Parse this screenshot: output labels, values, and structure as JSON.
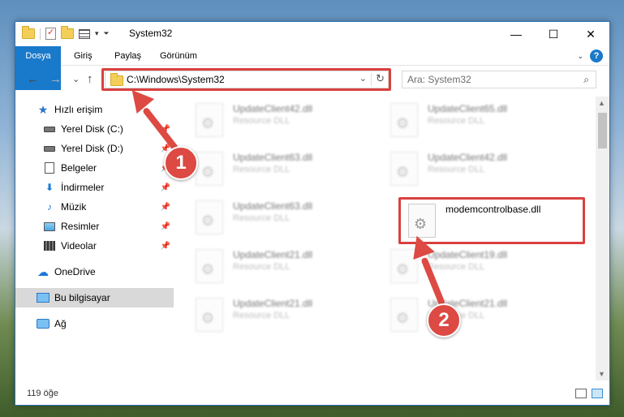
{
  "window": {
    "title": "System32",
    "controls": {
      "minimize": "—",
      "maximize": "☐",
      "close": "✕"
    }
  },
  "ribbon": {
    "tabs": [
      {
        "label": "Dosya",
        "active": true
      },
      {
        "label": "Giriş"
      },
      {
        "label": "Paylaş"
      },
      {
        "label": "Görünüm"
      }
    ],
    "help": "?"
  },
  "navigation": {
    "back": "←",
    "forward": "→",
    "recent": "⌄",
    "up": "↑",
    "address": "C:\\Windows\\System32",
    "search_placeholder": "Ara: System32"
  },
  "sidebar": {
    "items": [
      {
        "label": "Hızlı erişim",
        "icon": "star-icon"
      },
      {
        "label": "Yerel Disk (C:)",
        "icon": "drive-icon",
        "pinned": true
      },
      {
        "label": "Yerel Disk (D:)",
        "icon": "drive-icon",
        "pinned": true
      },
      {
        "label": "Belgeler",
        "icon": "documents-icon",
        "pinned": true
      },
      {
        "label": "İndirmeler",
        "icon": "downloads-icon",
        "pinned": true
      },
      {
        "label": "Müzik",
        "icon": "music-icon",
        "pinned": true
      },
      {
        "label": "Resimler",
        "icon": "pictures-icon",
        "pinned": true
      },
      {
        "label": "Videolar",
        "icon": "videos-icon",
        "pinned": true
      },
      {
        "label": "OneDrive",
        "icon": "cloud-icon"
      },
      {
        "label": "Bu bilgisayar",
        "icon": "computer-icon",
        "selected": true
      },
      {
        "label": "Ağ",
        "icon": "network-icon"
      }
    ]
  },
  "files": [
    {
      "name": "UpdateClient42.dll",
      "type": "Resource DLL"
    },
    {
      "name": "UpdateClient65.dll",
      "type": "Resource DLL"
    },
    {
      "name": "UpdateClient63.dll",
      "type": "Resource DLL"
    },
    {
      "name": "UpdateClient42.dll",
      "type": "Resource DLL"
    },
    {
      "name": "UpdateClient63.dll",
      "type": "Resource DLL"
    },
    {
      "name": "modemcontrolbase.dll",
      "type": ""
    },
    {
      "name": "UpdateClient21.dll",
      "type": "Resource DLL"
    },
    {
      "name": "UpdateClient19.dll",
      "type": "Resource DLL"
    },
    {
      "name": "UpdateClient21.dll",
      "type": "Resource DLL"
    },
    {
      "name": "UpdateClient21.dll",
      "type": "Resource DLL"
    }
  ],
  "status": {
    "count": "119 öğe"
  },
  "annotations": {
    "step1": "1",
    "step2": "2"
  },
  "colors": {
    "accent": "#1979ca",
    "highlight": "#d9403f"
  }
}
